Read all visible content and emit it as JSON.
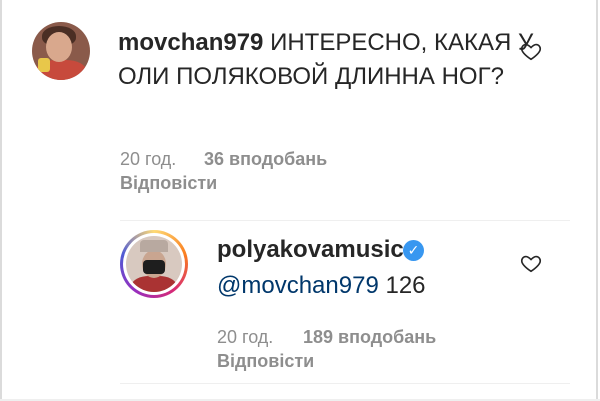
{
  "comment": {
    "username": "movchan979",
    "text": "ИНТЕРЕСНО, КАКАЯ У ОЛИ ПОЛЯКОВОЙ ДЛИННА НОГ?",
    "time": "20 год.",
    "likes": "36 вподобань",
    "reply_label": "Відповісти"
  },
  "reply": {
    "username": "polyakovamusic",
    "mention": "@movchan979",
    "text": " 126",
    "time": "20 год.",
    "likes": "189 вподобань",
    "reply_label": "Відповісти",
    "verified": true
  },
  "icons": {
    "like": "heart-outline-icon",
    "verified": "verified-badge-icon"
  },
  "colors": {
    "text": "#262626",
    "muted": "#8e8e8e",
    "mention": "#00376b",
    "verified": "#3897f0"
  }
}
